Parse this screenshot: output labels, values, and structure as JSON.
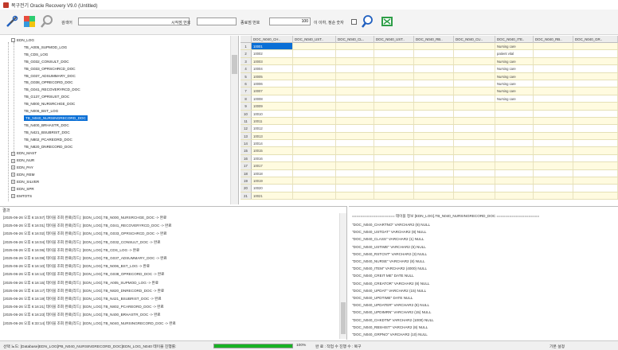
{
  "window": {
    "title": "복구전기 Oracle Recovery V9.0 (Untitled)"
  },
  "toolbar": {
    "label1": "검색어",
    "label2": "시작점 번호",
    "label3": "종료점 번호",
    "value3": "100",
    "label4": "이 이하, 정순 숫자",
    "check_label": "",
    "icons": [
      "tools-icon",
      "cube-icon",
      "search-icon",
      "magnifier-icon",
      "export-icon"
    ]
  },
  "tree": {
    "items": [
      {
        "label": "EDN_LOG",
        "indent": 1,
        "expander": "-"
      },
      {
        "label": "TB_A005_SUPMOD_LOG",
        "indent": 3
      },
      {
        "label": "TB_CDS_LOG",
        "indent": 3
      },
      {
        "label": "TB_G032_CONSULT_DOC",
        "indent": 3
      },
      {
        "label": "TB_G033_OPRSCHRCD_DOC",
        "indent": 3
      },
      {
        "label": "TB_G037_ADSUMMARY_DOC",
        "indent": 3
      },
      {
        "label": "TB_G038_OPRECORD_DOC",
        "indent": 3
      },
      {
        "label": "TB_G041_RECOVERYRCD_DOC",
        "indent": 3
      },
      {
        "label": "TB_G137_OPRSUST_DOC",
        "indent": 3
      },
      {
        "label": "TB_N000_NURSRCHGE_DOC",
        "indent": 3
      },
      {
        "label": "TB_N006_BST_LOG",
        "indent": 3
      },
      {
        "label": "TB_N040_NURSINGRECORD_DOC",
        "indent": 3,
        "selected": true
      },
      {
        "label": "TB_N400_BRHASTR_DOC",
        "indent": 3
      },
      {
        "label": "TB_N421_BSUBRIST_DOC",
        "indent": 3
      },
      {
        "label": "TB_N802_PCAREORD_DOC",
        "indent": 3
      },
      {
        "label": "TB_N820_DNRECORD_DOC",
        "indent": 3
      },
      {
        "label": "EDN_MAST",
        "indent": 1,
        "expander": "+"
      },
      {
        "label": "EDN_NUR",
        "indent": 1,
        "expander": "+"
      },
      {
        "label": "EDN_PAY",
        "indent": 1,
        "expander": "+"
      },
      {
        "label": "EDN_REM",
        "indent": 1,
        "expander": "+"
      },
      {
        "label": "EDN_SILVER",
        "indent": 1,
        "expander": "+"
      },
      {
        "label": "EDN_SPR",
        "indent": 1,
        "expander": "+"
      },
      {
        "label": "EMTOTS",
        "indent": 1,
        "expander": "+"
      }
    ]
  },
  "grid": {
    "columns": [
      "",
      "DOC_N040_CH..",
      "DOC_N040_UST..",
      "DOC_N040_CL..",
      "DOC_N040_UST..",
      "DOC_N040_RB..",
      "DOC_N040_CU..",
      "DOC_N040_ITE..",
      "DOC_N040_RB..",
      "DOC_N040_GR.."
    ],
    "rows": [
      [
        "1",
        "10001"
      ],
      [
        "2",
        "10002"
      ],
      [
        "3",
        "10003"
      ],
      [
        "4",
        "10004"
      ],
      [
        "5",
        "10005"
      ],
      [
        "6",
        "10006"
      ],
      [
        "7",
        "10007"
      ],
      [
        "8",
        "10008"
      ],
      [
        "9",
        "10009"
      ],
      [
        "10",
        "10010"
      ],
      [
        "11",
        "10011"
      ],
      [
        "12",
        "10012"
      ],
      [
        "13",
        "10013"
      ],
      [
        "14",
        "10014"
      ],
      [
        "15",
        "10015"
      ],
      [
        "16",
        "10016"
      ],
      [
        "17",
        "10017"
      ],
      [
        "18",
        "10018"
      ],
      [
        "19",
        "10019"
      ],
      [
        "20",
        "10020"
      ],
      [
        "21",
        "10021"
      ]
    ],
    "col8_samples": [
      "Nursing care",
      "patient vital",
      "Nursing care",
      "Nursing care",
      "Nursing care",
      "Nursing care",
      "Nursing care",
      "Nursing care"
    ]
  },
  "log": {
    "title": "결과",
    "lines": [
      "[2025-06-26 오후 6:15:57] 테이블 조회 완료(리드): [EDN_LOG].TB_N000_NURSRCHGE_DOC -> 완료",
      "[2025-06-26 오후 6:16:01] 테이블 조회 완료(리드): [EDN_LOG].TB_G041_RECOVERYRCD_DOC -> 완료",
      "[2025-06-26 오후 6:16:02] 테이블 조회 완료(리드): [EDN_LOG].TB_G033_OPRSCHRCD_DOC -> 완료",
      "[2025-06-26 오후 6:16:04] 테이블 조회 완료(리드): [EDN_LOG].TB_G032_CONSULT_DOC -> 완료",
      "[2025-06-26 오후 6:16:06] 테이블 조회 완료(리드): [EDN_LOG].TB_CDS_LOG -> 완료",
      "[2025-06-26 오후 6:16:08] 테이블 조회 완료(리드): [EDN_LOG].TB_G037_ADSUMMARY_DOC -> 완료",
      "[2025-06-26 오후 6:16:10] 테이블 조회 완료(리드): [EDN_LOG].TB_N006_BST_LOG -> 완료",
      "[2025-06-26 오후 6:16:13] 테이블 조회 완료(리드): [EDN_LOG].TB_G038_OPRECORD_DOC -> 완료",
      "[2025-06-26 오후 6:16:15] 테이블 조회 완료(리드): [EDN_LOG].TB_A005_SUPMOD_LOG -> 완료",
      "[2025-06-26 오후 6:16:17] 테이블 조회 완료(리드): [EDN_LOG].TB_N820_DNRECORD_DOC -> 완료",
      "[2025-06-26 오후 6:16:19] 테이블 조회 완료(리드): [EDN_LOG].TB_N421_BSUBRIST_DOC -> 완료",
      "[2025-06-26 오후 6:16:21] 테이블 조회 완료(리드): [EDN_LOG].TB_N802_PCAREORD_DOC -> 완료",
      "[2025-06-26 오후 6:16:23] 테이블 조회 완료(리드): [EDN_LOG].TB_N400_BRHASTR_DOC -> 완료",
      "[2025-06-26 오후 6:33:14] 테이블 조회 완료(리드): [EDN_LOG].TB_N040_NURSINGRECORD_DOC -> 완료"
    ]
  },
  "ddl": {
    "header": "==================== 테이블 정보 [EDN_LOG].TB_N040_NURSINGRECORD_DOC ====================",
    "lines": [
      "\"DOC_N040_CHARTNO\" VARCHAR2 (8) NULL",
      "\"DOC_N040_USTDAT\" VARCHAR2 (8) NULL",
      "\"DOC_N040_CLASS\" VARCHAR2 (1) NULL",
      "\"DOC_N040_USTIME\" VARCHAR2 (6) NULL",
      "\"DOC_N040_RSTCNT\" VARCHAR2 (3) NULL",
      "\"DOC_N040_NURSE\" VARCHAR2 (8) NULL",
      "\"DOC_N040_ITEM\" VARCHAR2 (4000) NULL",
      "\"DOC_N040_CREIT ME\" DATE NULL",
      "\"DOC_N040_CREATOR\" VARCHAR2 (8) NULL",
      "\"DOC_N040_UPDAT\" VARCHAR2 (15) NULL",
      "\"DOC_N040_UPDTIME\" DATE NULL",
      "\"DOC_N040_UPDATER\" VARCHAR2 (8) NULL",
      "\"DOC_N040_UPDIMRN\" VARCHAR2 (15) NULL",
      "\"DOC_N040_CHKDTM\" VARCHAR2 (1000) NULL",
      "\"DOC_N040_RBSHIST\" VARCHAR2 (8) NULL",
      "\"DOC_N040_GRPNO\" VARCHAR2 (10) NULL"
    ]
  },
  "status": {
    "text": "선택 노드: [Database]EDN_LOG[PB_N040_NURSINGRECORD_DOC]EDN_LOG_N040 테이블 진행률:",
    "progress_pct": 100,
    "progress_label": "100%",
    "message": "완 료 : 작업 수 진행 수 : 복구",
    "right": "기본 설정"
  }
}
